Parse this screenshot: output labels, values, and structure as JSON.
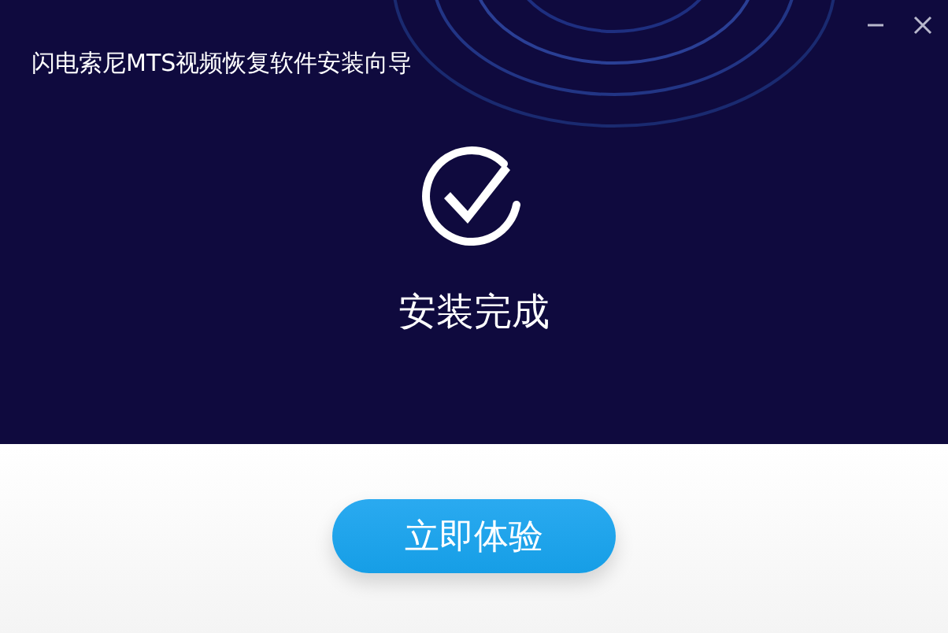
{
  "window": {
    "title": "闪电索尼MTS视频恢复软件安装向导"
  },
  "status": {
    "text": "安装完成"
  },
  "button": {
    "label": "立即体验"
  }
}
